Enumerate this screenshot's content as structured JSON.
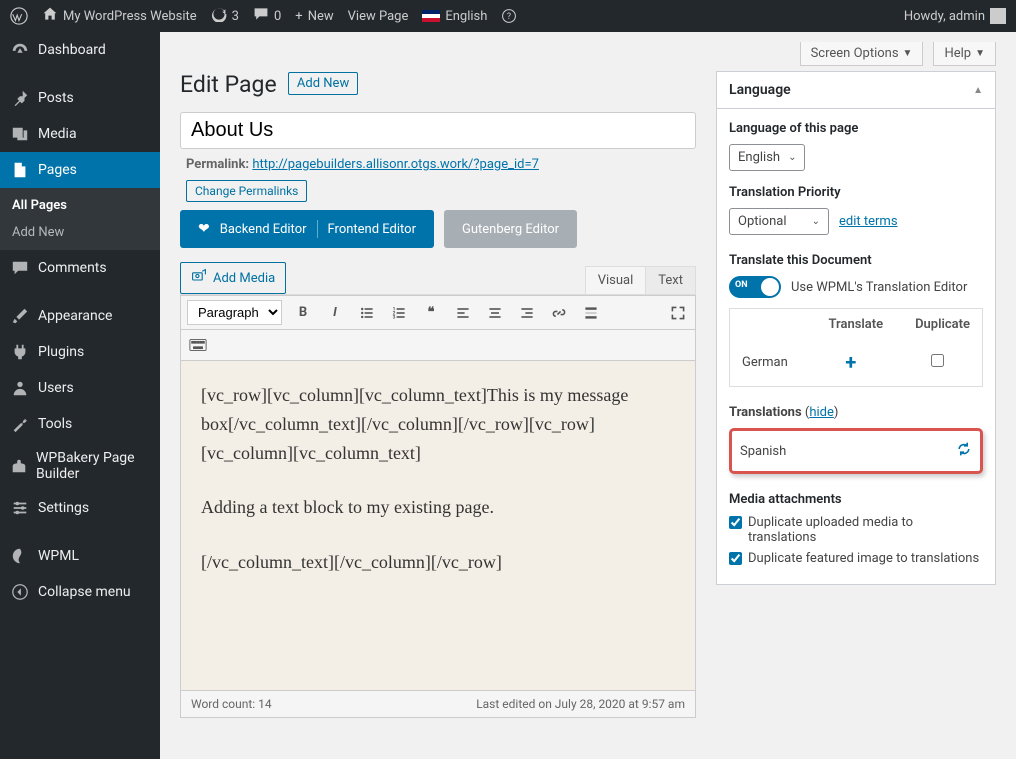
{
  "adminbar": {
    "sitename": "My WordPress Website",
    "updates": "3",
    "comments": "0",
    "new": "New",
    "viewpage": "View Page",
    "lang": "English",
    "howdy": "Howdy, admin"
  },
  "sidebar": {
    "dashboard": "Dashboard",
    "posts": "Posts",
    "media": "Media",
    "pages": "Pages",
    "pages_all": "All Pages",
    "pages_add": "Add New",
    "comments": "Comments",
    "appearance": "Appearance",
    "plugins": "Plugins",
    "users": "Users",
    "tools": "Tools",
    "wpbakery": "WPBakery Page Builder",
    "settings": "Settings",
    "wpml": "WPML",
    "collapse": "Collapse menu"
  },
  "top": {
    "screenopts": "Screen Options",
    "help": "Help"
  },
  "page": {
    "heading": "Edit Page",
    "addnew": "Add New",
    "title": "About Us",
    "permalink_label": "Permalink:",
    "permalink_url": "http://pagebuilders.allisonr.otgs.work/?page_id=7",
    "change_permalinks": "Change Permalinks",
    "btn_backend": "Backend Editor",
    "btn_frontend": "Frontend Editor",
    "btn_gutenberg": "Gutenberg Editor",
    "add_media": "Add Media",
    "tab_visual": "Visual",
    "tab_text": "Text",
    "para": "Paragraph",
    "content_p1": "[vc_row][vc_column][vc_column_text]This is my message box[/vc_column_text][/vc_column][/vc_row][vc_row][vc_column][vc_column_text]",
    "content_p2": "Adding a text block to my existing page.",
    "content_p3": "[/vc_column_text][/vc_column][/vc_row]",
    "wordcount": "Word count: 14",
    "lastedit": "Last edited on July 28, 2020 at 9:57 am"
  },
  "lang": {
    "box_title": "Language",
    "lang_label": "Language of this page",
    "lang_value": "English",
    "prio_label": "Translation Priority",
    "prio_value": "Optional",
    "edit_terms": "edit terms",
    "translate_doc": "Translate this Document",
    "toggle_on": "ON",
    "use_wpml": "Use WPML's Translation Editor",
    "th_translate": "Translate",
    "th_duplicate": "Duplicate",
    "row_german": "German",
    "translations_lbl": "Translations",
    "hide": "hide",
    "spanish": "Spanish",
    "media_lbl": "Media attachments",
    "chk1": "Duplicate uploaded media to translations",
    "chk2": "Duplicate featured image to translations"
  }
}
